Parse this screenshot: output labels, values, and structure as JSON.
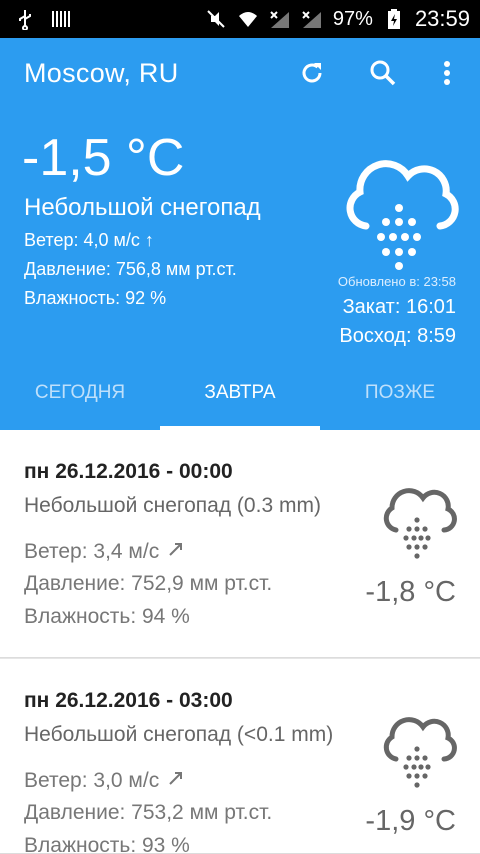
{
  "status_bar": {
    "battery_percent": "97%",
    "time": "23:59"
  },
  "header": {
    "city": "Moscow, RU",
    "temperature": "-1,5 °C",
    "description": "Небольшой снегопад",
    "wind": "Ветер: 4,0 м/с ↑",
    "pressure": "Давление: 756,8 мм рт.ст.",
    "humidity": "Влажность: 92 %",
    "updated": "Обновлено в: 23:58",
    "sunset": "Закат: 16:01",
    "sunrise": "Восход: 8:59",
    "icon": "cloud-snow-icon"
  },
  "tabs": [
    {
      "label": "СЕГОДНЯ",
      "active": false
    },
    {
      "label": "ЗАВТРА",
      "active": true
    },
    {
      "label": "ПОЗЖЕ",
      "active": false
    }
  ],
  "forecast": [
    {
      "date": "пн 26.12.2016 - 00:00",
      "description": "Небольшой снегопад (0.3 mm)",
      "wind": "Ветер: 3,4 м/с",
      "pressure": "Давление: 752,9 мм рт.ст.",
      "humidity": "Влажность: 94 %",
      "temperature": "-1,8 °C",
      "icon": "cloud-snow-icon"
    },
    {
      "date": "пн 26.12.2016 - 03:00",
      "description": "Небольшой снегопад (<0.1 mm)",
      "wind": "Ветер: 3,0 м/с",
      "pressure": "Давление: 753,2 мм рт.ст.",
      "humidity": "Влажность: 93 %",
      "temperature": "-1,9 °C",
      "icon": "cloud-snow-icon"
    }
  ],
  "colors": {
    "header_bg": "#2c9cf0",
    "tab_inactive": "#bfe0fb"
  }
}
